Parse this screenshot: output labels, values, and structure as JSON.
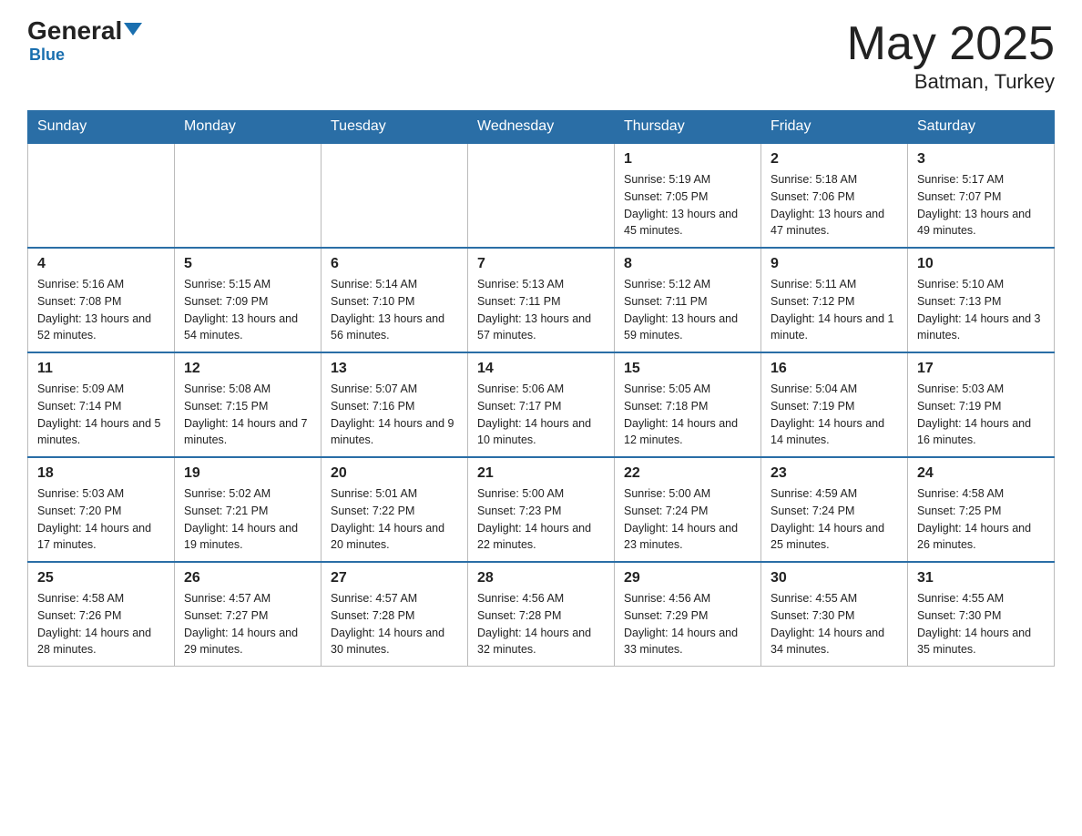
{
  "header": {
    "logo_general": "General",
    "logo_blue": "Blue",
    "month_title": "May 2025",
    "location": "Batman, Turkey"
  },
  "days_of_week": [
    "Sunday",
    "Monday",
    "Tuesday",
    "Wednesday",
    "Thursday",
    "Friday",
    "Saturday"
  ],
  "weeks": [
    [
      {
        "day": "",
        "info": ""
      },
      {
        "day": "",
        "info": ""
      },
      {
        "day": "",
        "info": ""
      },
      {
        "day": "",
        "info": ""
      },
      {
        "day": "1",
        "info": "Sunrise: 5:19 AM\nSunset: 7:05 PM\nDaylight: 13 hours and 45 minutes."
      },
      {
        "day": "2",
        "info": "Sunrise: 5:18 AM\nSunset: 7:06 PM\nDaylight: 13 hours and 47 minutes."
      },
      {
        "day": "3",
        "info": "Sunrise: 5:17 AM\nSunset: 7:07 PM\nDaylight: 13 hours and 49 minutes."
      }
    ],
    [
      {
        "day": "4",
        "info": "Sunrise: 5:16 AM\nSunset: 7:08 PM\nDaylight: 13 hours and 52 minutes."
      },
      {
        "day": "5",
        "info": "Sunrise: 5:15 AM\nSunset: 7:09 PM\nDaylight: 13 hours and 54 minutes."
      },
      {
        "day": "6",
        "info": "Sunrise: 5:14 AM\nSunset: 7:10 PM\nDaylight: 13 hours and 56 minutes."
      },
      {
        "day": "7",
        "info": "Sunrise: 5:13 AM\nSunset: 7:11 PM\nDaylight: 13 hours and 57 minutes."
      },
      {
        "day": "8",
        "info": "Sunrise: 5:12 AM\nSunset: 7:11 PM\nDaylight: 13 hours and 59 minutes."
      },
      {
        "day": "9",
        "info": "Sunrise: 5:11 AM\nSunset: 7:12 PM\nDaylight: 14 hours and 1 minute."
      },
      {
        "day": "10",
        "info": "Sunrise: 5:10 AM\nSunset: 7:13 PM\nDaylight: 14 hours and 3 minutes."
      }
    ],
    [
      {
        "day": "11",
        "info": "Sunrise: 5:09 AM\nSunset: 7:14 PM\nDaylight: 14 hours and 5 minutes."
      },
      {
        "day": "12",
        "info": "Sunrise: 5:08 AM\nSunset: 7:15 PM\nDaylight: 14 hours and 7 minutes."
      },
      {
        "day": "13",
        "info": "Sunrise: 5:07 AM\nSunset: 7:16 PM\nDaylight: 14 hours and 9 minutes."
      },
      {
        "day": "14",
        "info": "Sunrise: 5:06 AM\nSunset: 7:17 PM\nDaylight: 14 hours and 10 minutes."
      },
      {
        "day": "15",
        "info": "Sunrise: 5:05 AM\nSunset: 7:18 PM\nDaylight: 14 hours and 12 minutes."
      },
      {
        "day": "16",
        "info": "Sunrise: 5:04 AM\nSunset: 7:19 PM\nDaylight: 14 hours and 14 minutes."
      },
      {
        "day": "17",
        "info": "Sunrise: 5:03 AM\nSunset: 7:19 PM\nDaylight: 14 hours and 16 minutes."
      }
    ],
    [
      {
        "day": "18",
        "info": "Sunrise: 5:03 AM\nSunset: 7:20 PM\nDaylight: 14 hours and 17 minutes."
      },
      {
        "day": "19",
        "info": "Sunrise: 5:02 AM\nSunset: 7:21 PM\nDaylight: 14 hours and 19 minutes."
      },
      {
        "day": "20",
        "info": "Sunrise: 5:01 AM\nSunset: 7:22 PM\nDaylight: 14 hours and 20 minutes."
      },
      {
        "day": "21",
        "info": "Sunrise: 5:00 AM\nSunset: 7:23 PM\nDaylight: 14 hours and 22 minutes."
      },
      {
        "day": "22",
        "info": "Sunrise: 5:00 AM\nSunset: 7:24 PM\nDaylight: 14 hours and 23 minutes."
      },
      {
        "day": "23",
        "info": "Sunrise: 4:59 AM\nSunset: 7:24 PM\nDaylight: 14 hours and 25 minutes."
      },
      {
        "day": "24",
        "info": "Sunrise: 4:58 AM\nSunset: 7:25 PM\nDaylight: 14 hours and 26 minutes."
      }
    ],
    [
      {
        "day": "25",
        "info": "Sunrise: 4:58 AM\nSunset: 7:26 PM\nDaylight: 14 hours and 28 minutes."
      },
      {
        "day": "26",
        "info": "Sunrise: 4:57 AM\nSunset: 7:27 PM\nDaylight: 14 hours and 29 minutes."
      },
      {
        "day": "27",
        "info": "Sunrise: 4:57 AM\nSunset: 7:28 PM\nDaylight: 14 hours and 30 minutes."
      },
      {
        "day": "28",
        "info": "Sunrise: 4:56 AM\nSunset: 7:28 PM\nDaylight: 14 hours and 32 minutes."
      },
      {
        "day": "29",
        "info": "Sunrise: 4:56 AM\nSunset: 7:29 PM\nDaylight: 14 hours and 33 minutes."
      },
      {
        "day": "30",
        "info": "Sunrise: 4:55 AM\nSunset: 7:30 PM\nDaylight: 14 hours and 34 minutes."
      },
      {
        "day": "31",
        "info": "Sunrise: 4:55 AM\nSunset: 7:30 PM\nDaylight: 14 hours and 35 minutes."
      }
    ]
  ]
}
